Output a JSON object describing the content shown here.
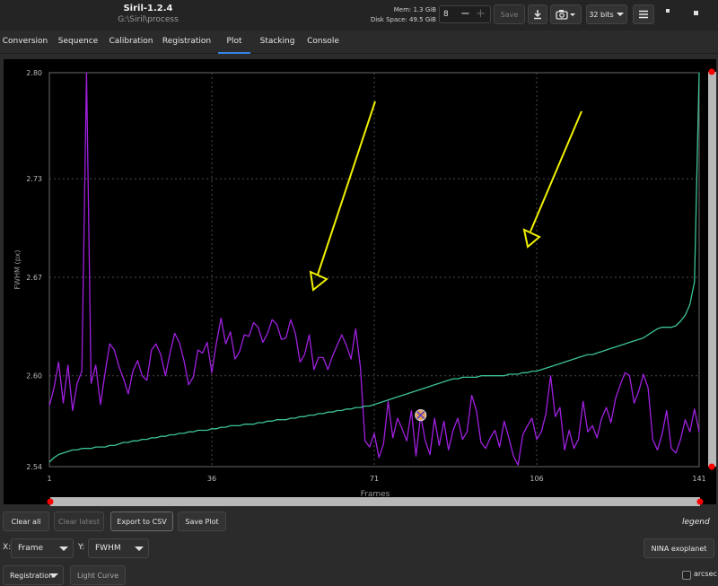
{
  "header": {
    "title": "Siril-1.2.4",
    "subtitle": "G:\\Siril\\process",
    "mem_label": "Mem: 1.3 GiB",
    "disk_label": "Disk Space: 49.5 GiB",
    "threads_value": "8",
    "save_label": "Save",
    "bits_label": "32 bits"
  },
  "tabs": [
    "Conversion",
    "Sequence",
    "Calibration",
    "Registration",
    "Plot",
    "Stacking",
    "Console"
  ],
  "active_tab": "Plot",
  "controls": {
    "clear_all": "Clear all",
    "clear_latest": "Clear latest",
    "export_csv": "Export to CSV",
    "save_plot": "Save Plot",
    "legend": "legend",
    "x_label": "X:",
    "x_value": "Frame",
    "y_label": "Y:",
    "y_value": "FWHM",
    "nina": "NINA exoplanet",
    "registration": "Registration",
    "light_curve": "Light Curve",
    "arcsec": "arcsec"
  },
  "colors": {
    "background": "#000000",
    "purple_series": "#a020e0",
    "green_series": "#3cc29a",
    "arrow": "#f0f000",
    "handle": "#ff0000"
  },
  "chart_data": {
    "type": "line",
    "xlabel": "Frames",
    "ylabel": "FWHM (px)",
    "xlim": [
      1,
      141
    ],
    "ylim": [
      2.54,
      2.8
    ],
    "x_ticks": [
      1,
      36,
      71,
      106,
      141
    ],
    "y_ticks": [
      2.54,
      2.6,
      2.67,
      2.73,
      2.8
    ],
    "y_tick_values": [
      2.54,
      2.6,
      2.665,
      2.73,
      2.8
    ],
    "grid": true,
    "highlight_frame": 81,
    "series": [
      {
        "values": [
          2.58,
          2.592,
          2.609,
          2.582,
          2.607,
          2.577,
          2.595,
          2.603,
          2.8,
          2.595,
          2.607,
          2.581,
          2.602,
          2.621,
          2.617,
          2.606,
          2.598,
          2.588,
          2.603,
          2.61,
          2.6,
          2.597,
          2.617,
          2.621,
          2.614,
          2.6,
          2.615,
          2.628,
          2.622,
          2.61,
          2.594,
          2.599,
          2.617,
          2.615,
          2.622,
          2.602,
          2.622,
          2.638,
          2.621,
          2.629,
          2.611,
          2.616,
          2.627,
          2.626,
          2.635,
          2.632,
          2.622,
          2.628,
          2.637,
          2.634,
          2.624,
          2.625,
          2.637,
          2.628,
          2.609,
          2.614,
          2.627,
          2.604,
          2.612,
          2.612,
          2.604,
          2.613,
          2.62,
          2.627,
          2.62,
          2.611,
          2.631,
          2.606,
          2.557,
          2.553,
          2.562,
          2.546,
          2.555,
          2.583,
          2.559,
          2.572,
          2.565,
          2.557,
          2.577,
          2.547,
          2.574,
          2.557,
          2.548,
          2.572,
          2.554,
          2.57,
          2.551,
          2.564,
          2.572,
          2.558,
          2.563,
          2.587,
          2.577,
          2.556,
          2.552,
          2.559,
          2.564,
          2.553,
          2.57,
          2.559,
          2.547,
          2.541,
          2.561,
          2.567,
          2.572,
          2.558,
          2.563,
          2.575,
          2.6,
          2.573,
          2.579,
          2.551,
          2.564,
          2.552,
          2.558,
          2.583,
          2.563,
          2.567,
          2.559,
          2.572,
          2.579,
          2.569,
          2.585,
          2.594,
          2.602,
          2.6,
          2.582,
          2.59,
          2.601,
          2.592,
          2.558,
          2.551,
          2.561,
          2.577,
          2.552,
          2.549,
          2.558,
          2.571,
          2.563,
          2.578,
          2.563
        ]
      },
      {
        "values": [
          2.543,
          2.546,
          2.548,
          2.549,
          2.55,
          2.551,
          2.551,
          2.552,
          2.552,
          2.552,
          2.553,
          2.553,
          2.553,
          2.554,
          2.554,
          2.555,
          2.556,
          2.556,
          2.557,
          2.557,
          2.558,
          2.558,
          2.559,
          2.559,
          2.56,
          2.56,
          2.561,
          2.561,
          2.562,
          2.562,
          2.563,
          2.563,
          2.564,
          2.564,
          2.564,
          2.565,
          2.565,
          2.566,
          2.566,
          2.567,
          2.567,
          2.567,
          2.568,
          2.568,
          2.568,
          2.569,
          2.569,
          2.57,
          2.57,
          2.571,
          2.571,
          2.571,
          2.572,
          2.572,
          2.573,
          2.573,
          2.574,
          2.574,
          2.575,
          2.575,
          2.576,
          2.576,
          2.577,
          2.577,
          2.578,
          2.578,
          2.579,
          2.579,
          2.58,
          2.58,
          2.581,
          2.582,
          2.583,
          2.584,
          2.585,
          2.586,
          2.587,
          2.588,
          2.589,
          2.59,
          2.591,
          2.592,
          2.593,
          2.594,
          2.595,
          2.596,
          2.597,
          2.598,
          2.598,
          2.599,
          2.599,
          2.599,
          2.599,
          2.6,
          2.6,
          2.6,
          2.6,
          2.6,
          2.6,
          2.601,
          2.601,
          2.601,
          2.602,
          2.602,
          2.603,
          2.603,
          2.604,
          2.605,
          2.606,
          2.607,
          2.608,
          2.609,
          2.61,
          2.611,
          2.612,
          2.613,
          2.614,
          2.614,
          2.615,
          2.616,
          2.617,
          2.618,
          2.619,
          2.62,
          2.621,
          2.622,
          2.623,
          2.624,
          2.625,
          2.627,
          2.629,
          2.631,
          2.632,
          2.632,
          2.632,
          2.633,
          2.636,
          2.64,
          2.647,
          2.662,
          2.8
        ]
      }
    ]
  }
}
